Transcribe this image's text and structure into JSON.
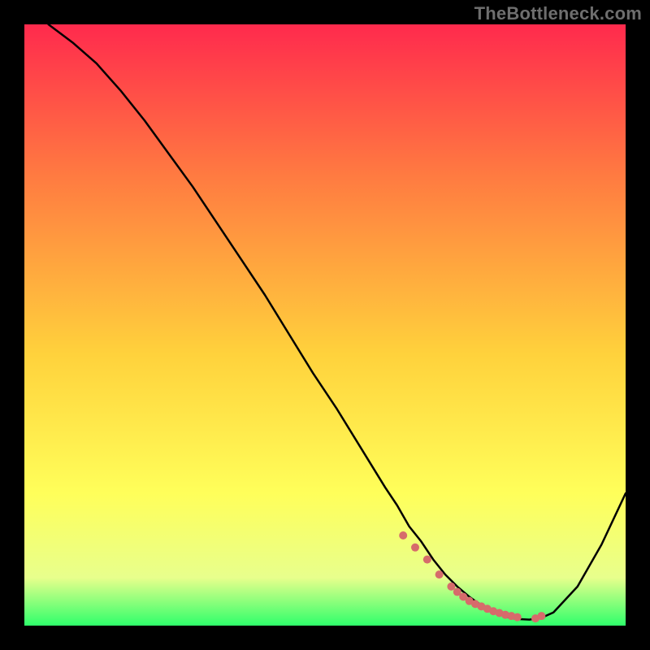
{
  "watermark": "TheBottleneck.com",
  "chart_data": {
    "type": "line",
    "title": "",
    "xlabel": "",
    "ylabel": "",
    "xlim": [
      0,
      100
    ],
    "ylim": [
      0,
      100
    ],
    "grid": false,
    "background_gradient": [
      "#ff2a4d",
      "#ff7a41",
      "#ffd23c",
      "#ffff5a",
      "#e8ff8c",
      "#2fff6b"
    ],
    "series": [
      {
        "name": "curve",
        "color": "#000000",
        "x": [
          4,
          8,
          12,
          16,
          20,
          24,
          28,
          32,
          36,
          40,
          44,
          48,
          52,
          56,
          60,
          62,
          64,
          66,
          68,
          70,
          72,
          74,
          76,
          78,
          80,
          82,
          84,
          86,
          88,
          92,
          96,
          100
        ],
        "values": [
          100,
          97,
          93.5,
          89,
          84,
          78.5,
          73,
          67,
          61,
          55,
          48.5,
          42,
          36,
          29.5,
          23,
          20,
          16.5,
          14,
          11,
          8.5,
          6.5,
          4.8,
          3.4,
          2.3,
          1.5,
          1.1,
          1.0,
          1.3,
          2.2,
          6.5,
          13.5,
          22
        ]
      },
      {
        "name": "bottom-markers",
        "color": "#d66b6b",
        "type": "scatter",
        "x": [
          63,
          65,
          67,
          69,
          71,
          72,
          73,
          74,
          75,
          76,
          77,
          78,
          79,
          80,
          81,
          82,
          85,
          86
        ],
        "values": [
          15,
          13,
          11,
          8.5,
          6.5,
          5.6,
          4.8,
          4.1,
          3.6,
          3.2,
          2.8,
          2.4,
          2.1,
          1.8,
          1.6,
          1.4,
          1.2,
          1.6
        ]
      }
    ]
  }
}
